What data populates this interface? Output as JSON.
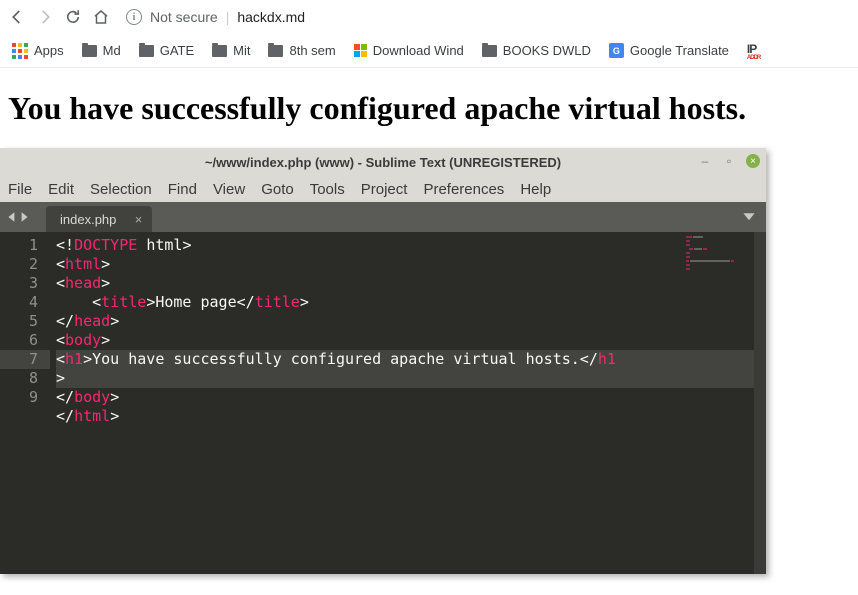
{
  "browser": {
    "security_label": "Not secure",
    "url": "hackdx.md"
  },
  "bookmarks": {
    "apps": "Apps",
    "items": [
      {
        "label": "Md"
      },
      {
        "label": "GATE"
      },
      {
        "label": "Mit"
      },
      {
        "label": "8th sem"
      }
    ],
    "download": "Download Wind",
    "books": "BOOKS DWLD",
    "translate": "Google Translate",
    "ip": "IP"
  },
  "page": {
    "heading": "You have successfully configured apache virtual hosts."
  },
  "sublime": {
    "title": "~/www/index.php (www) - Sublime Text (UNREGISTERED)",
    "menu": [
      "File",
      "Edit",
      "Selection",
      "Find",
      "View",
      "Goto",
      "Tools",
      "Project",
      "Preferences",
      "Help"
    ],
    "tab": "index.php",
    "lines": [
      "1",
      "2",
      "3",
      "4",
      "5",
      "6",
      "7",
      "",
      "8",
      "9"
    ],
    "code": {
      "doctype_kw": "DOCTYPE",
      "doctype_arg": "html",
      "html": "html",
      "head": "head",
      "title": "title",
      "title_text": "Home page",
      "body": "body",
      "h1": "h1",
      "h1_text": "You have successfully configured apache virtual hosts."
    }
  }
}
